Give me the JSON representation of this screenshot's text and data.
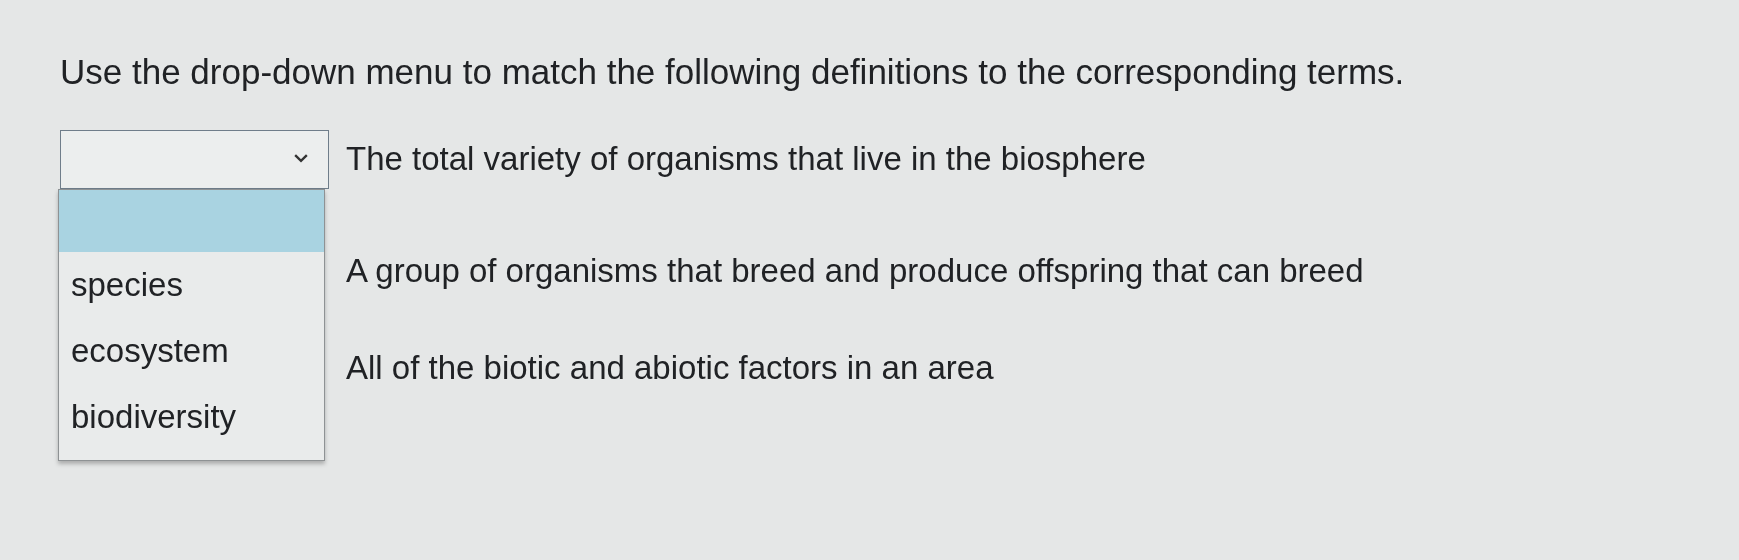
{
  "instructions": "Use the drop-down menu to match the following definitions to the corresponding terms.",
  "matches": [
    {
      "definition": "The total variety of organisms that live in the biosphere",
      "dropdown": {
        "open": true,
        "options": [
          {
            "kind": "blank",
            "selected": true
          },
          {
            "kind": "term",
            "label": "species",
            "selected": false
          },
          {
            "kind": "term",
            "label": "ecosystem",
            "selected": false
          },
          {
            "kind": "term",
            "label": "biodiversity",
            "selected": false
          }
        ]
      }
    },
    {
      "definition": "A group of organisms that breed and produce offspring that can breed"
    },
    {
      "definition": "All of the biotic and abiotic factors in an area"
    }
  ]
}
